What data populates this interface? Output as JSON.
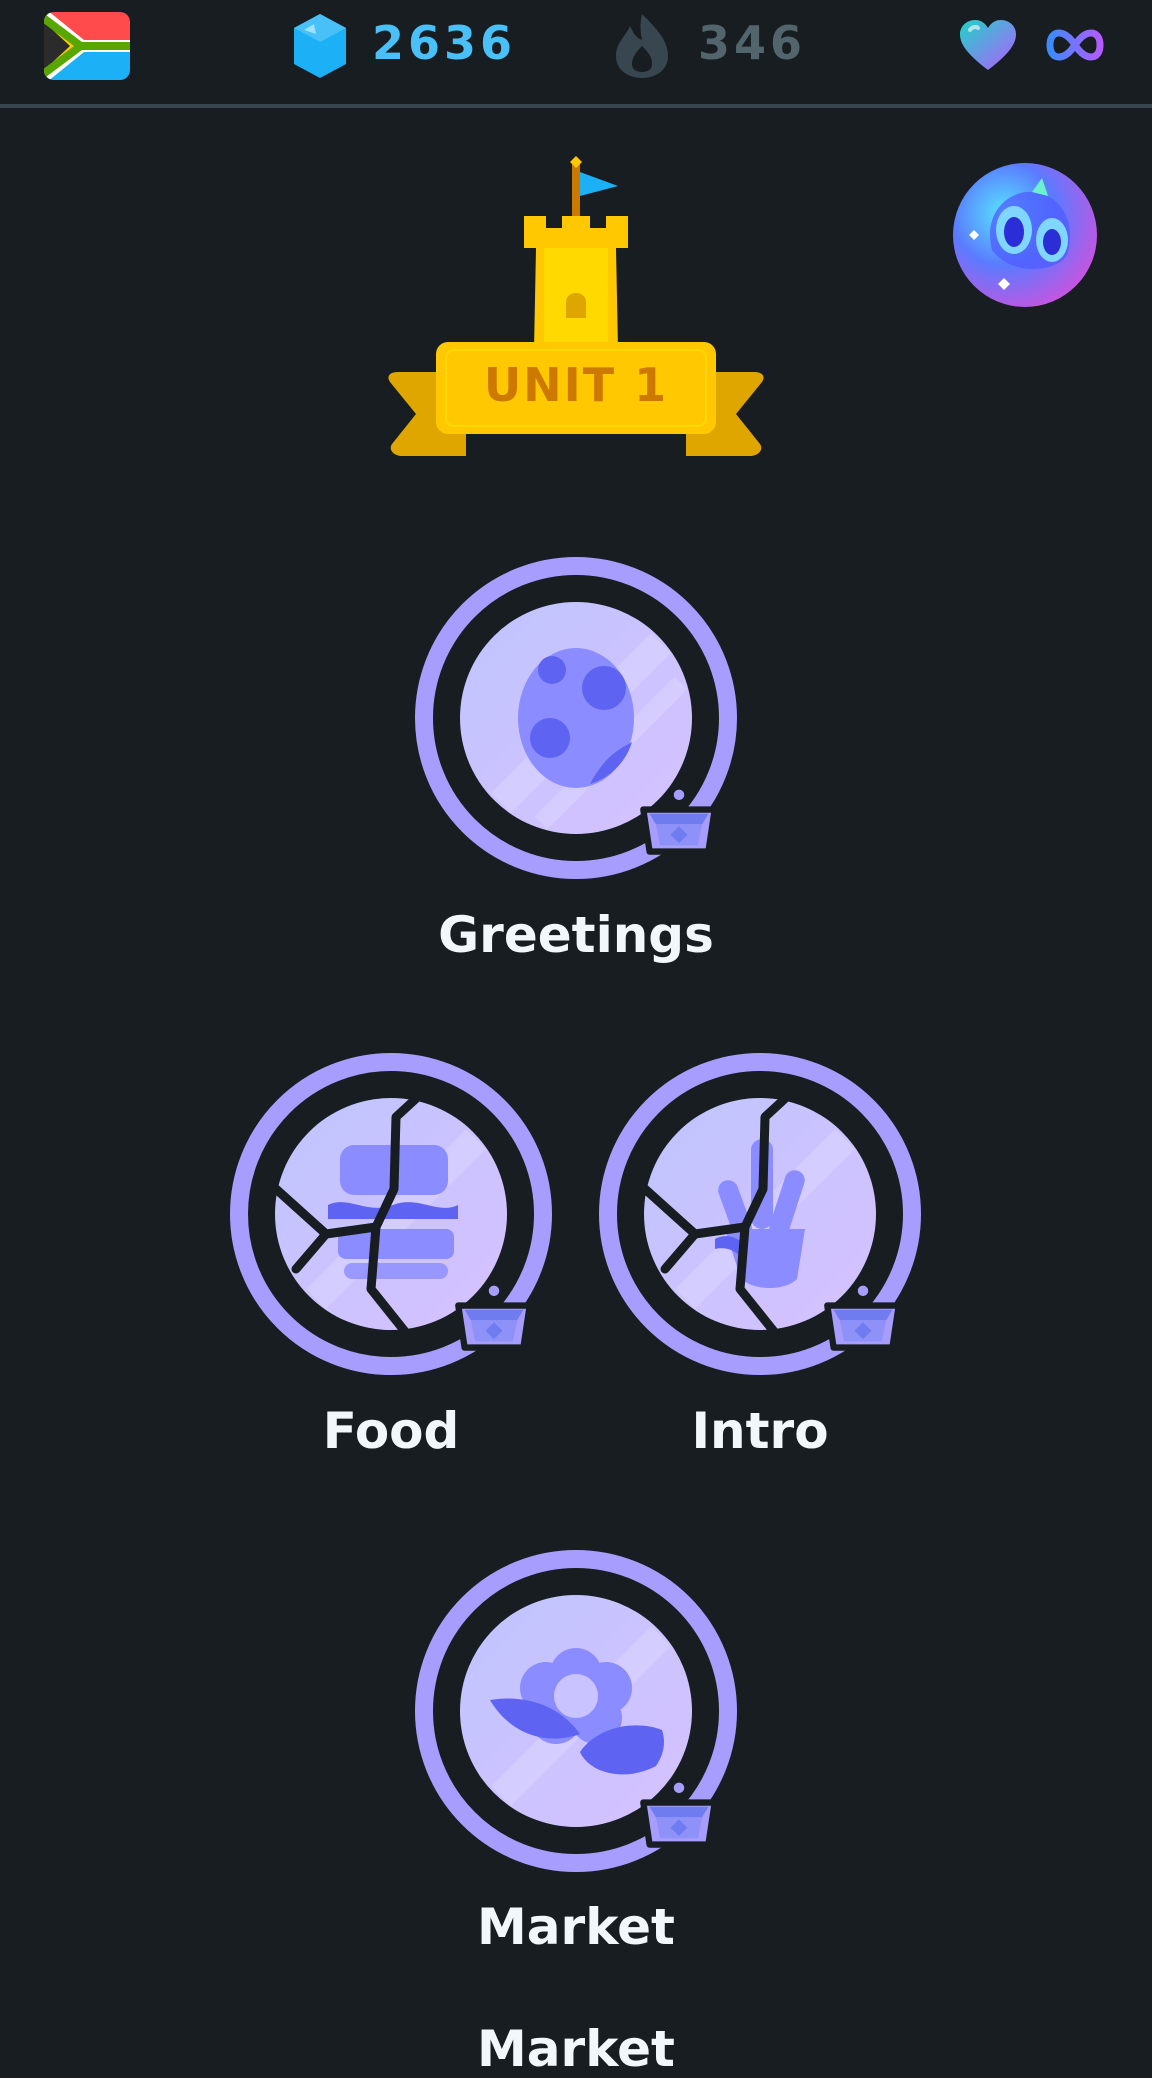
{
  "header": {
    "flag_icon": "south-africa-flag-icon",
    "gems": "2636",
    "streak": "346",
    "hearts": "∞",
    "colors": {
      "gems": "#49c0f8",
      "streak": "#52656d",
      "background": "#171d20"
    }
  },
  "unit": {
    "label": "UNIT 1"
  },
  "skills": [
    {
      "name": "Greetings",
      "icon": "egg-icon",
      "state": "normal"
    },
    {
      "name": "Food",
      "icon": "burger-icon",
      "state": "cracked"
    },
    {
      "name": "Intro",
      "icon": "hand-wave-icon",
      "state": "cracked"
    },
    {
      "name": "Market",
      "icon": "flower-icon",
      "state": "normal"
    },
    {
      "name": "Market",
      "icon": "",
      "state": "partially-visible"
    }
  ],
  "colors": {
    "ring": "#a79dff",
    "node_fill_light": "#dcd3ff",
    "node_fill_dark": "#a7a7ff",
    "icon": "#6b74f5",
    "crown": "#6e7cf0",
    "castle": "#ffc800",
    "ribbon": "#e0a600"
  }
}
